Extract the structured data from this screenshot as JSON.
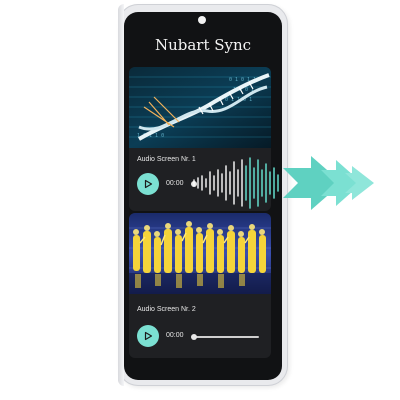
{
  "app": {
    "title": "Nubart Sync"
  },
  "tracks": [
    {
      "title": "Audio Screen Nr. 1",
      "time": "00:00",
      "thumbnail": "dna-helix-image",
      "play_icon": "play-icon"
    },
    {
      "title": "Audio Screen Nr. 2",
      "time": "00:00",
      "thumbnail": "dancers-image",
      "play_icon": "play-icon"
    }
  ],
  "sync_arrow": {
    "icon": "double-arrow-right-icon",
    "color": "#5fd1c1"
  },
  "colors": {
    "accent": "#7be0d2",
    "screen_bg": "#111214",
    "card_bg": "#1f2023"
  }
}
